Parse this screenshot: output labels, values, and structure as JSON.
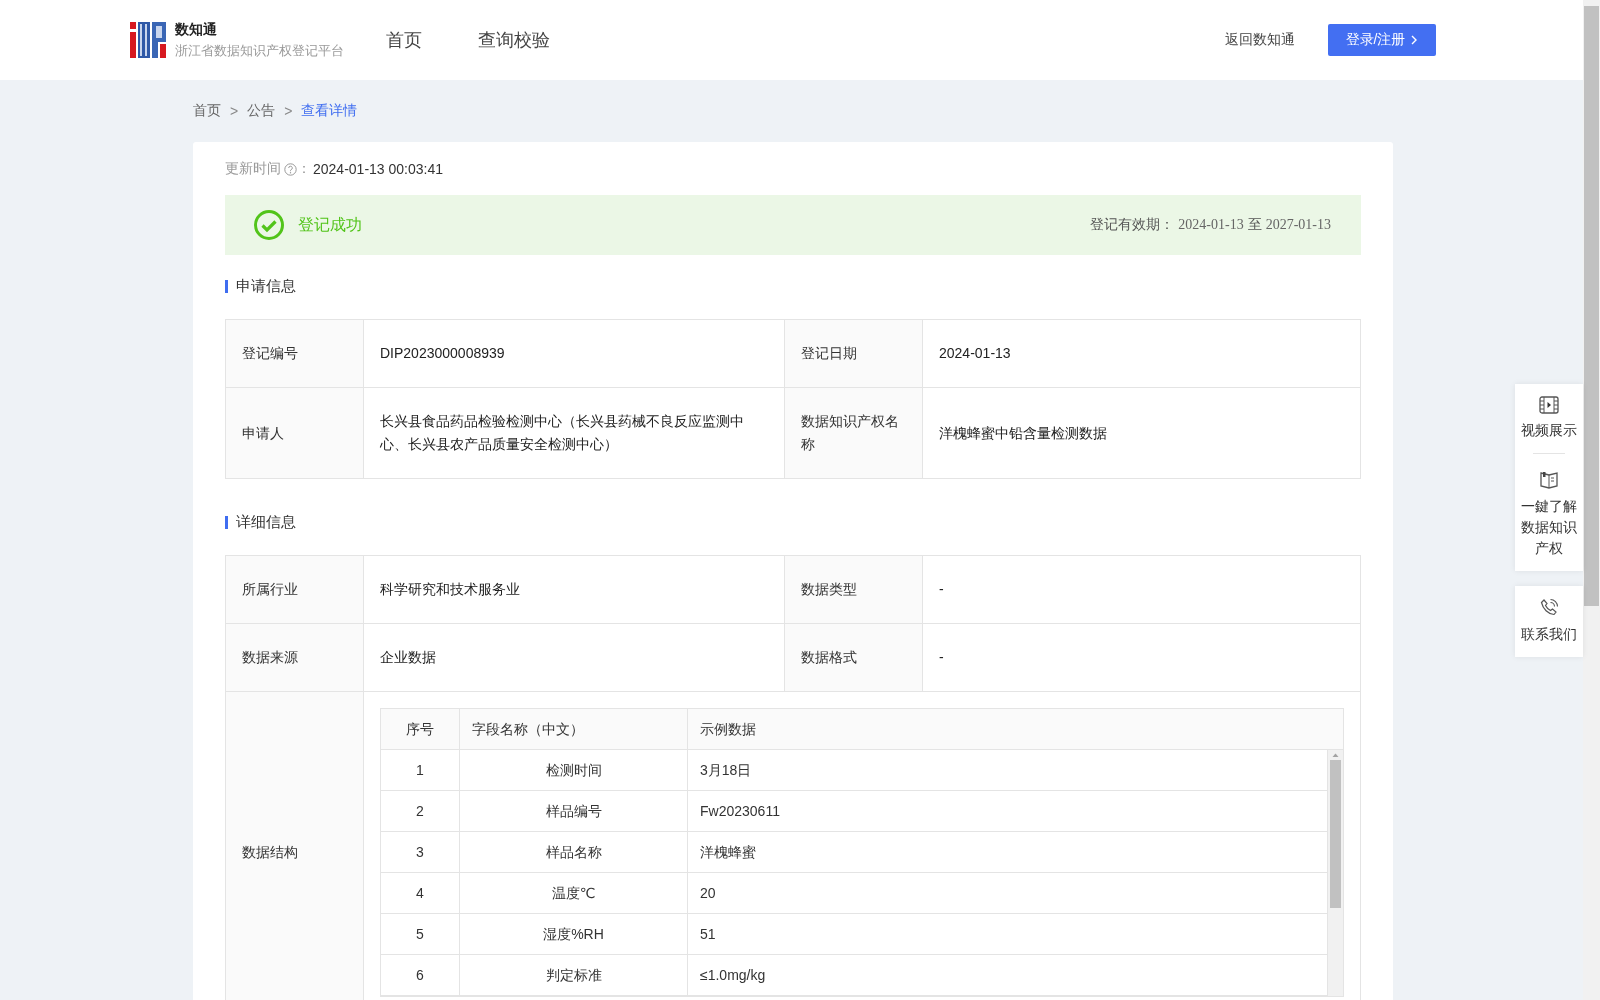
{
  "header": {
    "brand": "数知通",
    "subtitle": "浙江省数据知识产权登记平台",
    "nav": [
      {
        "label": "首页",
        "selected": false
      },
      {
        "label": "查询校验",
        "selected": false
      }
    ],
    "back_link": "返回数知通",
    "login_button": "登录/注册"
  },
  "breadcrumb": [
    {
      "label": "首页",
      "current": false
    },
    {
      "label": "公告",
      "current": false
    },
    {
      "label": "查看详情",
      "current": true
    }
  ],
  "breadcrumb_separator": ">",
  "update": {
    "label": "更新时间",
    "colon": "：",
    "value": "2024-01-13 00:03:41"
  },
  "status": {
    "kind": "success",
    "text": "登记成功",
    "validity_label": "登记有效期：",
    "validity_from": "2024-01-13",
    "validity_sep": "至",
    "validity_to": "2027-01-13"
  },
  "sections": [
    {
      "title": "申请信息",
      "rows": [
        [
          "登记编号",
          "DIP2023000008939",
          "登记日期",
          "2024-01-13"
        ],
        [
          "申请人",
          "长兴县食品药品检验检测中心（长兴县药械不良反应监测中心、长兴县农产品质量安全检测中心）",
          "数据知识产权名称",
          "洋槐蜂蜜中铅含量检测数据"
        ]
      ]
    },
    {
      "title": "详细信息",
      "rows": [
        [
          "所属行业",
          "科学研究和技术服务业",
          "数据类型",
          "-"
        ],
        [
          "数据来源",
          "企业数据",
          "数据格式",
          "-"
        ]
      ],
      "structure": {
        "label": "数据结构",
        "columns": [
          "序号",
          "字段名称（中文）",
          "示例数据"
        ],
        "rows": [
          [
            "1",
            "检测时间",
            "3月18日"
          ],
          [
            "2",
            "样品编号",
            "Fw20230611"
          ],
          [
            "3",
            "样品名称",
            "洋槐蜂蜜"
          ],
          [
            "4",
            "温度℃",
            "20"
          ],
          [
            "5",
            "湿度%RH",
            "51"
          ],
          [
            "6",
            "判定标准",
            "≤1.0mg/kg"
          ]
        ]
      }
    }
  ],
  "side_panel": [
    {
      "kind": "video",
      "label": "视频展示"
    },
    {
      "kind": "book",
      "label": "一鍵了解数据知识产权"
    },
    {
      "kind": "phone",
      "label": "联系我们"
    }
  ]
}
